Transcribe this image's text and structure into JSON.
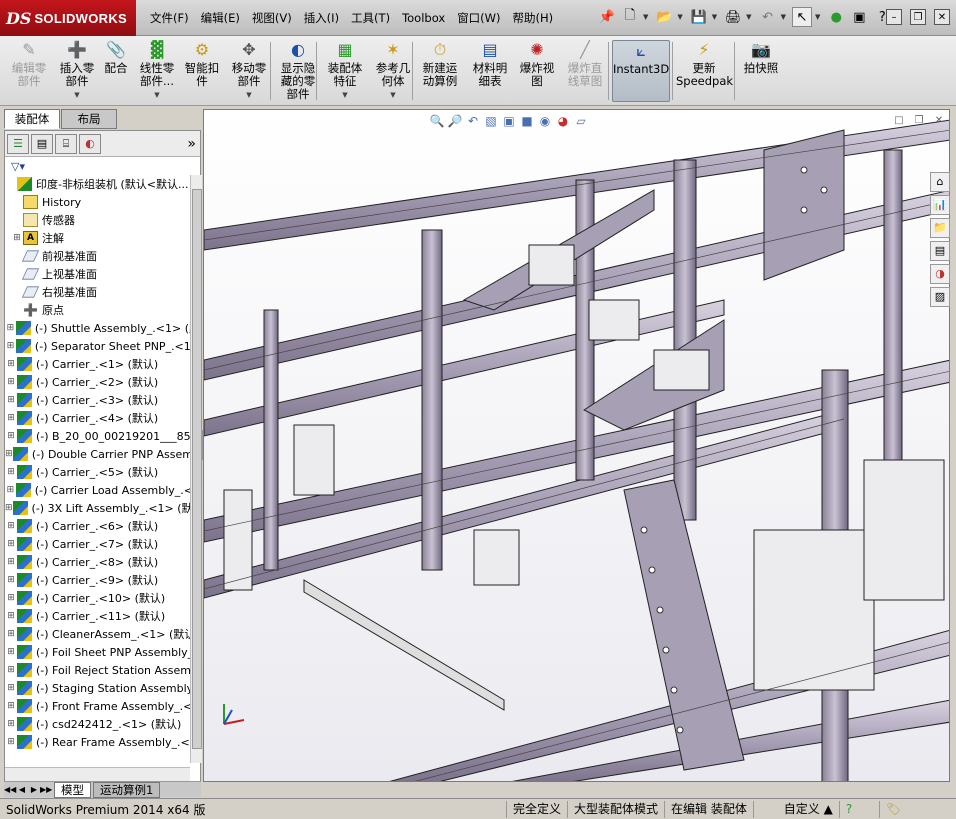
{
  "app": {
    "logo_mark": "DS",
    "logo_text": "SOLIDWORKS"
  },
  "menu": [
    "文件(F)",
    "编辑(E)",
    "视图(V)",
    "插入(I)",
    "工具(T)",
    "Toolbox",
    "窗口(W)",
    "帮助(H)"
  ],
  "quick_access": {
    "icons": [
      "pin-icon",
      "new-document-icon",
      "open-icon",
      "save-icon",
      "print-icon",
      "undo-icon",
      "select-icon",
      "rebuild-icon",
      "options-icon",
      "help-icon"
    ]
  },
  "window_controls": [
    "minimize",
    "restore",
    "close"
  ],
  "ribbon": [
    {
      "label": "编辑零\n部件",
      "disabled": true,
      "icon": "edit-component-icon"
    },
    {
      "label": "插入零\n部件",
      "icon": "insert-component-icon",
      "dropdown": true
    },
    {
      "label": "配合",
      "icon": "mate-icon"
    },
    {
      "label": "线性零\n部件...",
      "icon": "linear-pattern-icon",
      "dropdown": true
    },
    {
      "label": "智能扣\n件",
      "icon": "smart-fastener-icon"
    },
    {
      "label": "移动零\n部件",
      "icon": "move-component-icon",
      "dropdown": true
    },
    {
      "label": "显示隐\n藏的零\n部件",
      "icon": "show-hidden-icon"
    },
    {
      "label": "装配体\n特征",
      "icon": "assembly-feature-icon",
      "dropdown": true
    },
    {
      "label": "参考几\n何体",
      "icon": "reference-geometry-icon",
      "dropdown": true
    },
    {
      "label": "新建运\n动算例",
      "icon": "motion-study-icon"
    },
    {
      "label": "材料明\n细表",
      "icon": "bom-icon"
    },
    {
      "label": "爆炸视\n图",
      "icon": "exploded-view-icon"
    },
    {
      "label": "爆炸直\n线草图",
      "disabled": true,
      "icon": "explode-line-icon"
    },
    {
      "label": "Instant3D",
      "active": true,
      "icon": "instant3d-icon"
    },
    {
      "label": "更新\nSpeedpak",
      "icon": "speedpak-icon"
    },
    {
      "label": "拍快照",
      "icon": "snapshot-icon"
    }
  ],
  "panel_tabs": [
    "装配体",
    "布局"
  ],
  "panel_toolbar": [
    "feature-tree-icon",
    "property-icon",
    "config-icon",
    "display-icon"
  ],
  "filter_icon": "filter-icon",
  "tree": [
    {
      "text": "印度-非标组装机  (默认<默认...",
      "type": "root"
    },
    {
      "text": "History",
      "type": "hist",
      "indent": 1
    },
    {
      "text": "传感器",
      "type": "sens",
      "indent": 1
    },
    {
      "text": "注解",
      "type": "note",
      "indent": 1,
      "expand": true
    },
    {
      "text": "前视基准面",
      "type": "plane",
      "indent": 1
    },
    {
      "text": "上视基准面",
      "type": "plane",
      "indent": 1
    },
    {
      "text": "右视基准面",
      "type": "plane",
      "indent": 1
    },
    {
      "text": "原点",
      "type": "orig",
      "indent": 1
    },
    {
      "text": "(-) Shuttle Assembly_.<1> (默",
      "type": "asm",
      "expand": true
    },
    {
      "text": "(-) Separator Sheet PNP_.<1>",
      "type": "asm",
      "expand": true
    },
    {
      "text": "(-) Carrier_.<1> (默认)",
      "type": "asm",
      "expand": true
    },
    {
      "text": "(-) Carrier_.<2> (默认)",
      "type": "asm",
      "expand": true
    },
    {
      "text": "(-) Carrier_.<3> (默认)",
      "type": "asm",
      "expand": true
    },
    {
      "text": "(-) Carrier_.<4> (默认)",
      "type": "asm",
      "expand": true
    },
    {
      "text": "(-) B_20_00_00219201___850",
      "type": "asm",
      "expand": true
    },
    {
      "text": "(-) Double Carrier PNP Assemb",
      "type": "asm",
      "expand": true
    },
    {
      "text": "(-) Carrier_.<5> (默认)",
      "type": "asm",
      "expand": true
    },
    {
      "text": "(-) Carrier Load Assembly_.<1",
      "type": "asm",
      "expand": true
    },
    {
      "text": "(-) 3X Lift Assembly_.<1> (默认",
      "type": "asm",
      "expand": true
    },
    {
      "text": "(-) Carrier_.<6> (默认)",
      "type": "asm",
      "expand": true
    },
    {
      "text": "(-) Carrier_.<7> (默认)",
      "type": "asm",
      "expand": true
    },
    {
      "text": "(-) Carrier_.<8> (默认)",
      "type": "asm",
      "expand": true
    },
    {
      "text": "(-) Carrier_.<9> (默认)",
      "type": "asm",
      "expand": true
    },
    {
      "text": "(-) Carrier_.<10> (默认)",
      "type": "asm",
      "expand": true
    },
    {
      "text": "(-) Carrier_.<11> (默认)",
      "type": "asm",
      "expand": true
    },
    {
      "text": "(-) CleanerAssem_.<1> (默认",
      "type": "asm",
      "expand": true
    },
    {
      "text": "(-) Foil Sheet PNP Assembly_.",
      "type": "asm",
      "expand": true
    },
    {
      "text": "(-) Foil Reject Station Assemb",
      "type": "asm",
      "expand": true
    },
    {
      "text": "(-) Staging Station Assembly_",
      "type": "asm",
      "expand": true
    },
    {
      "text": "(-) Front Frame Assembly_.<1",
      "type": "asm",
      "expand": true
    },
    {
      "text": "(-) csd242412_.<1> (默认)",
      "type": "asm",
      "expand": true
    },
    {
      "text": "(-) Rear Frame Assembly_.<1",
      "type": "asm",
      "expand": true
    }
  ],
  "bottom_tabs": [
    "模型",
    "运动算例1"
  ],
  "status": {
    "product": "SolidWorks Premium 2014 x64 版",
    "fully_defined": "完全定义",
    "large_assembly": "大型装配体模式",
    "editing": "在编辑 装配体",
    "custom": "自定义"
  }
}
